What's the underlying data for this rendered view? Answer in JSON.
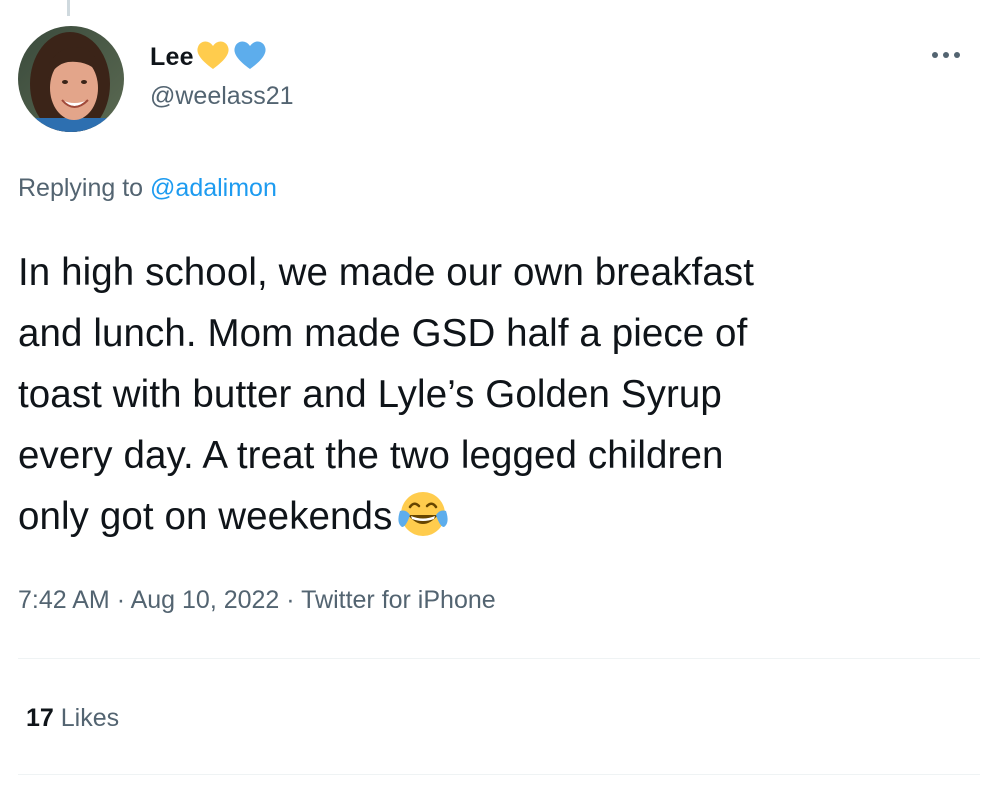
{
  "author": {
    "display_name": "Lee",
    "handle": "@weelass21",
    "badges": [
      "yellow-heart-icon",
      "blue-heart-icon"
    ],
    "badge_colors": [
      "#ffcc4d",
      "#5dadec"
    ]
  },
  "menu": {
    "icon": "more-options-icon",
    "label": "•••"
  },
  "reply": {
    "prefix": "Replying to",
    "mention": "@adalimon"
  },
  "tweet": {
    "lines": [
      "In high school, we made our own breakfast",
      "and lunch.  Mom made GSD half a piece of",
      "toast with butter and Lyle’s Golden Syrup",
      "every day.  A treat the two legged children",
      "only got on weekends"
    ],
    "emoji": "face-with-tears-of-joy-icon"
  },
  "meta": {
    "time": "7:42 AM",
    "separator": "·",
    "date": "Aug 10, 2022",
    "source": "Twitter for iPhone"
  },
  "stats": {
    "likes_count": "17",
    "likes_label": "Likes"
  },
  "colors": {
    "text_primary": "#0f1419",
    "text_secondary": "#536471",
    "link": "#1d9bf0",
    "divider": "#eff3f4"
  }
}
